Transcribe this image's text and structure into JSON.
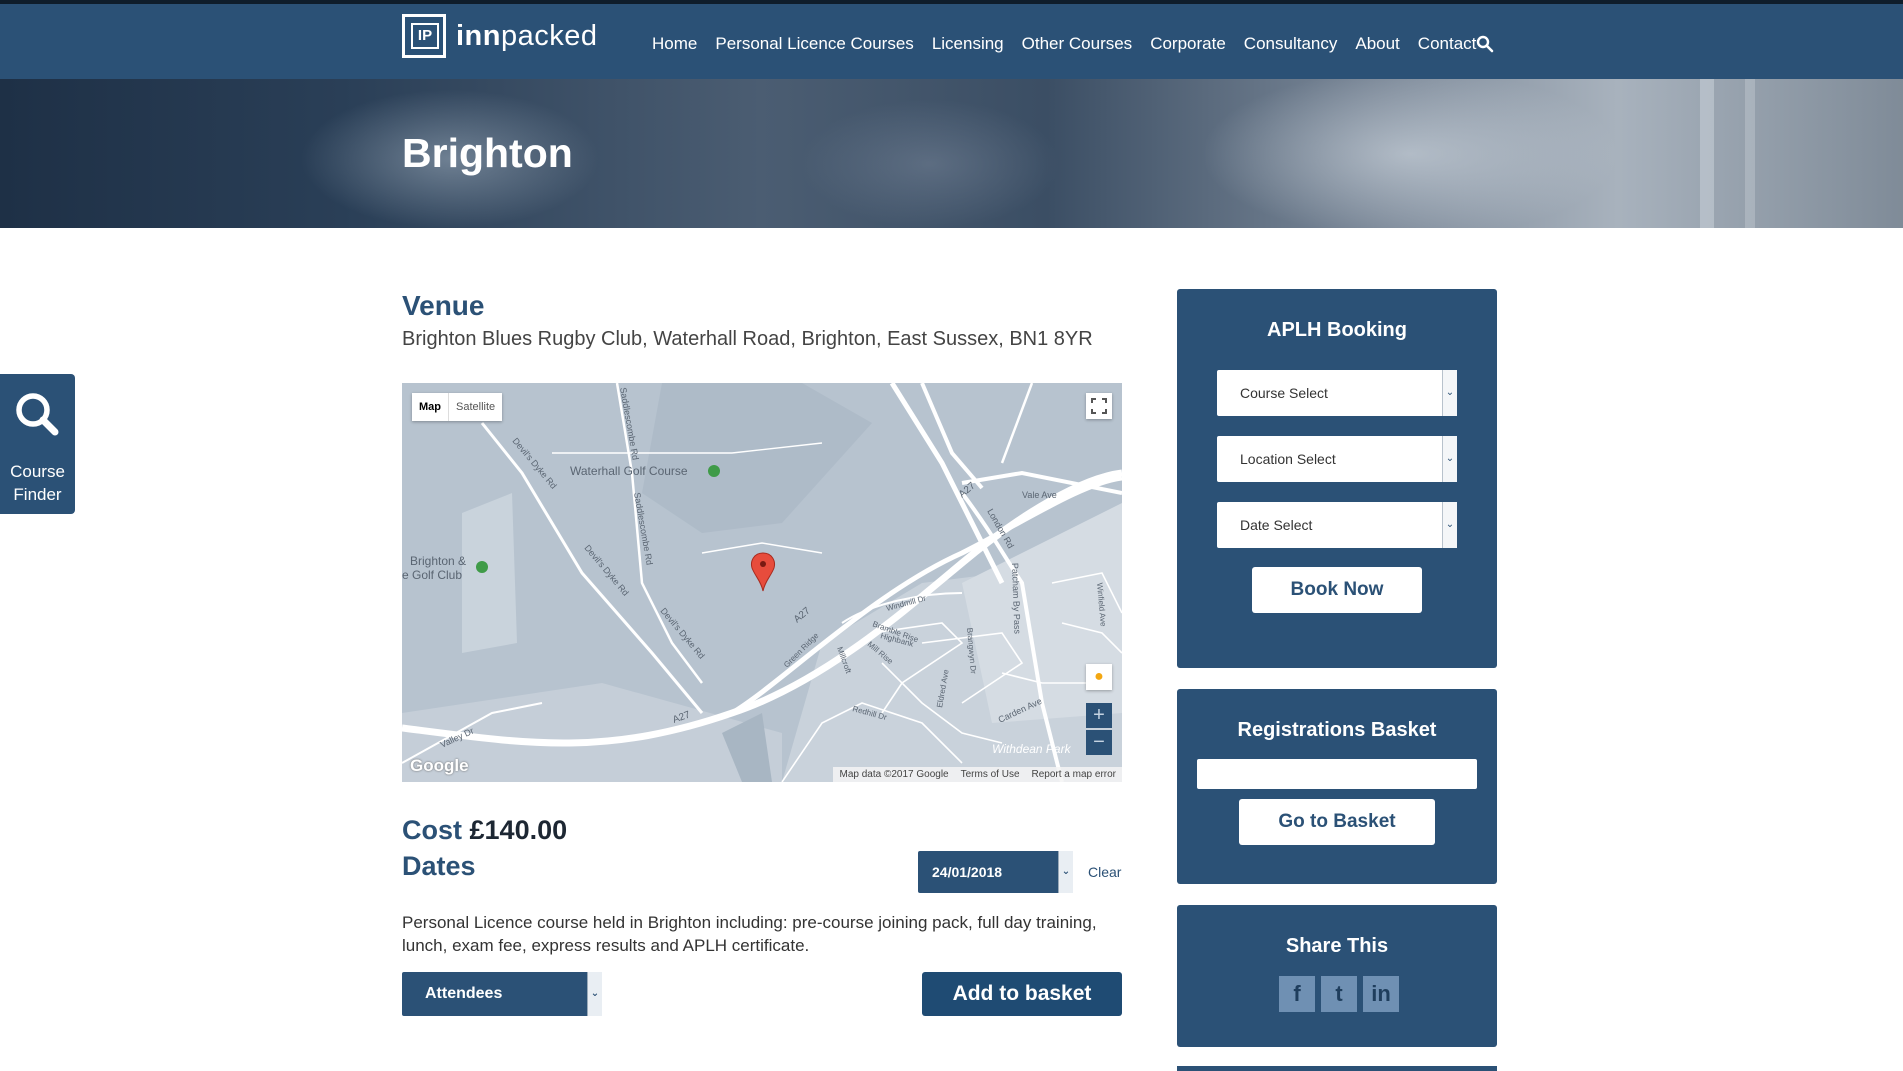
{
  "header": {
    "logo_mark": "IP",
    "logo_text_bold": "inn",
    "logo_text_rest": "packed",
    "nav": [
      "Home",
      "Personal Licence Courses",
      "Licensing",
      "Other Courses",
      "Corporate",
      "Consultancy",
      "About",
      "Contact"
    ]
  },
  "hero": {
    "title": "Brighton"
  },
  "course_finder": {
    "label_line1": "Course",
    "label_line2": "Finder"
  },
  "venue": {
    "heading": "Venue",
    "address": "Brighton Blues Rugby Club, Waterhall Road, Brighton, East Sussex, BN1 8YR"
  },
  "map": {
    "type_map": "Map",
    "type_satellite": "Satellite",
    "zoom_in": "+",
    "zoom_out": "−",
    "brand": "Google",
    "footer": [
      "Map data ©2017 Google",
      "Terms of Use",
      "Report a map error"
    ],
    "labels": {
      "waterhall": "Waterhall Golf Course",
      "brighton_golf_1": "Brighton &",
      "brighton_golf_2": "e Golf Club",
      "a27_top": "A27",
      "a27_mid": "A27",
      "a27_low": "A27",
      "london_rd": "London Rd",
      "vale_ave": "Vale Ave",
      "patcham": "Patcham By Pass",
      "windmill": "Windmill Dr",
      "bramble": "Bramble Rise",
      "highbank": "Highbank",
      "mill_rise": "Mill Rise",
      "green_ridge": "Green Ridge",
      "millcroft": "Millcroft",
      "redhill": "Redhill Dr",
      "eldred": "Eldred Ave",
      "carden": "Carden Ave",
      "withdean": "Withdean Park",
      "devils_dyke_1": "Devil's Dyke Rd",
      "devils_dyke_2": "Devil's Dyke Rd",
      "devils_dyke_3": "Devil's Dyke Rd",
      "saddlescombe_1": "Saddlescombe Rd",
      "saddlescombe_2": "Saddlescombe Rd",
      "valley_dr": "Valley Dr",
      "winfield": "Winfield Ave",
      "brangwyn": "Brangwyn Dr"
    }
  },
  "course": {
    "cost_label": "Cost",
    "cost_value": "£140.00",
    "dates_label": "Dates",
    "date_selected": "24/01/2018",
    "clear": "Clear",
    "description": "Personal Licence course held in Brighton including: pre-course joining pack, full day training, lunch, exam fee, express results and APLH certificate.",
    "attendees": "Attendees",
    "add_to_basket": "Add to basket"
  },
  "booking": {
    "title": "APLH Booking",
    "course_select": "Course Select",
    "location_select": "Location Select",
    "date_select": "Date Select",
    "book_now": "Book Now"
  },
  "basket": {
    "title": "Registrations Basket",
    "go": "Go to Basket"
  },
  "share": {
    "title": "Share This",
    "icons": [
      "f",
      "t",
      "in"
    ]
  },
  "colors": {
    "brand_blue": "#2b5176",
    "map_land": "#b7c3cf",
    "map_road": "#ffffff"
  }
}
